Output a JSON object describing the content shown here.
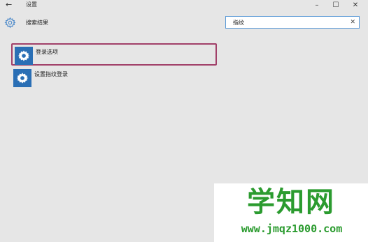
{
  "window": {
    "back_icon": "back-arrow-icon",
    "title": "设置",
    "controls": [
      "minimize-icon",
      "maximize-icon",
      "close-icon"
    ]
  },
  "header": {
    "icon": "gear-icon",
    "title": "搜索结果"
  },
  "search": {
    "value": "指纹",
    "clear_icon": "close-icon"
  },
  "results": [
    {
      "label": "登录选项",
      "icon": "gear-icon",
      "selected": true
    },
    {
      "label": "设置指纹登录",
      "icon": "gear-icon",
      "selected": false
    }
  ],
  "watermark": {
    "title": "学知网",
    "url": "www.jmqz1000.com"
  },
  "colors": {
    "accent": "#2a6fb5",
    "selection_border": "#a14069",
    "search_border": "#5d9bd6",
    "watermark": "#2b9b2f"
  }
}
